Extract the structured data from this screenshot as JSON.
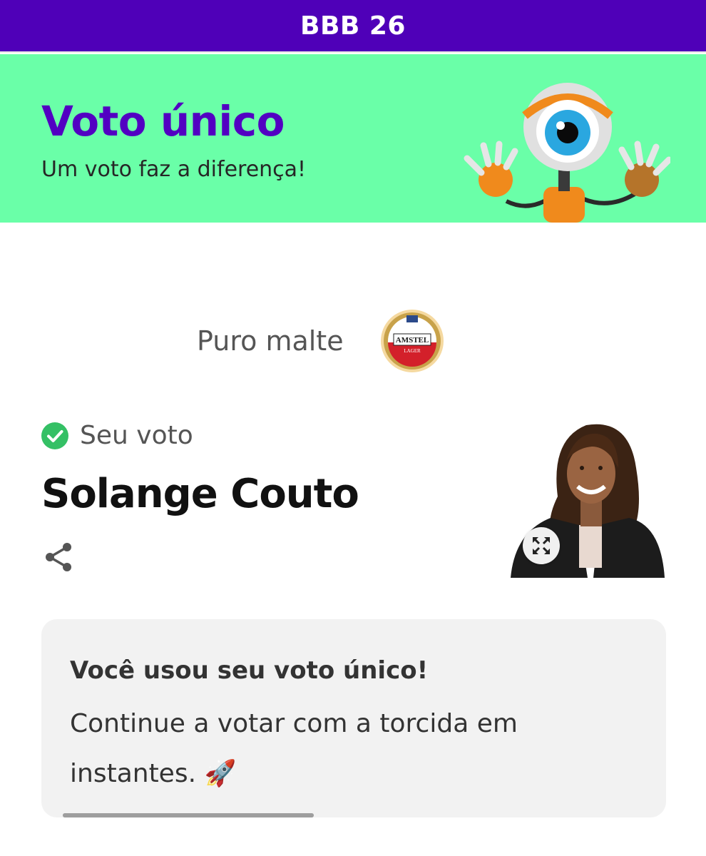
{
  "header": {
    "title": "BBB 26"
  },
  "hero": {
    "title": "Voto único",
    "subtitle": "Um voto faz a diferença!"
  },
  "sponsor": {
    "tagline": "Puro malte",
    "logo_text_top": "AMSTEL",
    "logo_text_bottom": "LAGER"
  },
  "vote": {
    "label": "Seu voto",
    "candidate": "Solange Couto"
  },
  "message": {
    "heading": "Você usou seu voto único!",
    "body": "Continue a votar com a torcida em instantes. 🚀"
  },
  "progress": {
    "value_fraction": 1.0
  },
  "colors": {
    "header_bg": "#4f00b8",
    "hero_bg": "#6affa8",
    "title_purple": "#5200c2",
    "check_green": "#34c065",
    "card_bg": "#f2f2f2"
  },
  "icons": {
    "share": "share-icon",
    "check": "check-circle-icon",
    "expand": "expand-icon"
  }
}
